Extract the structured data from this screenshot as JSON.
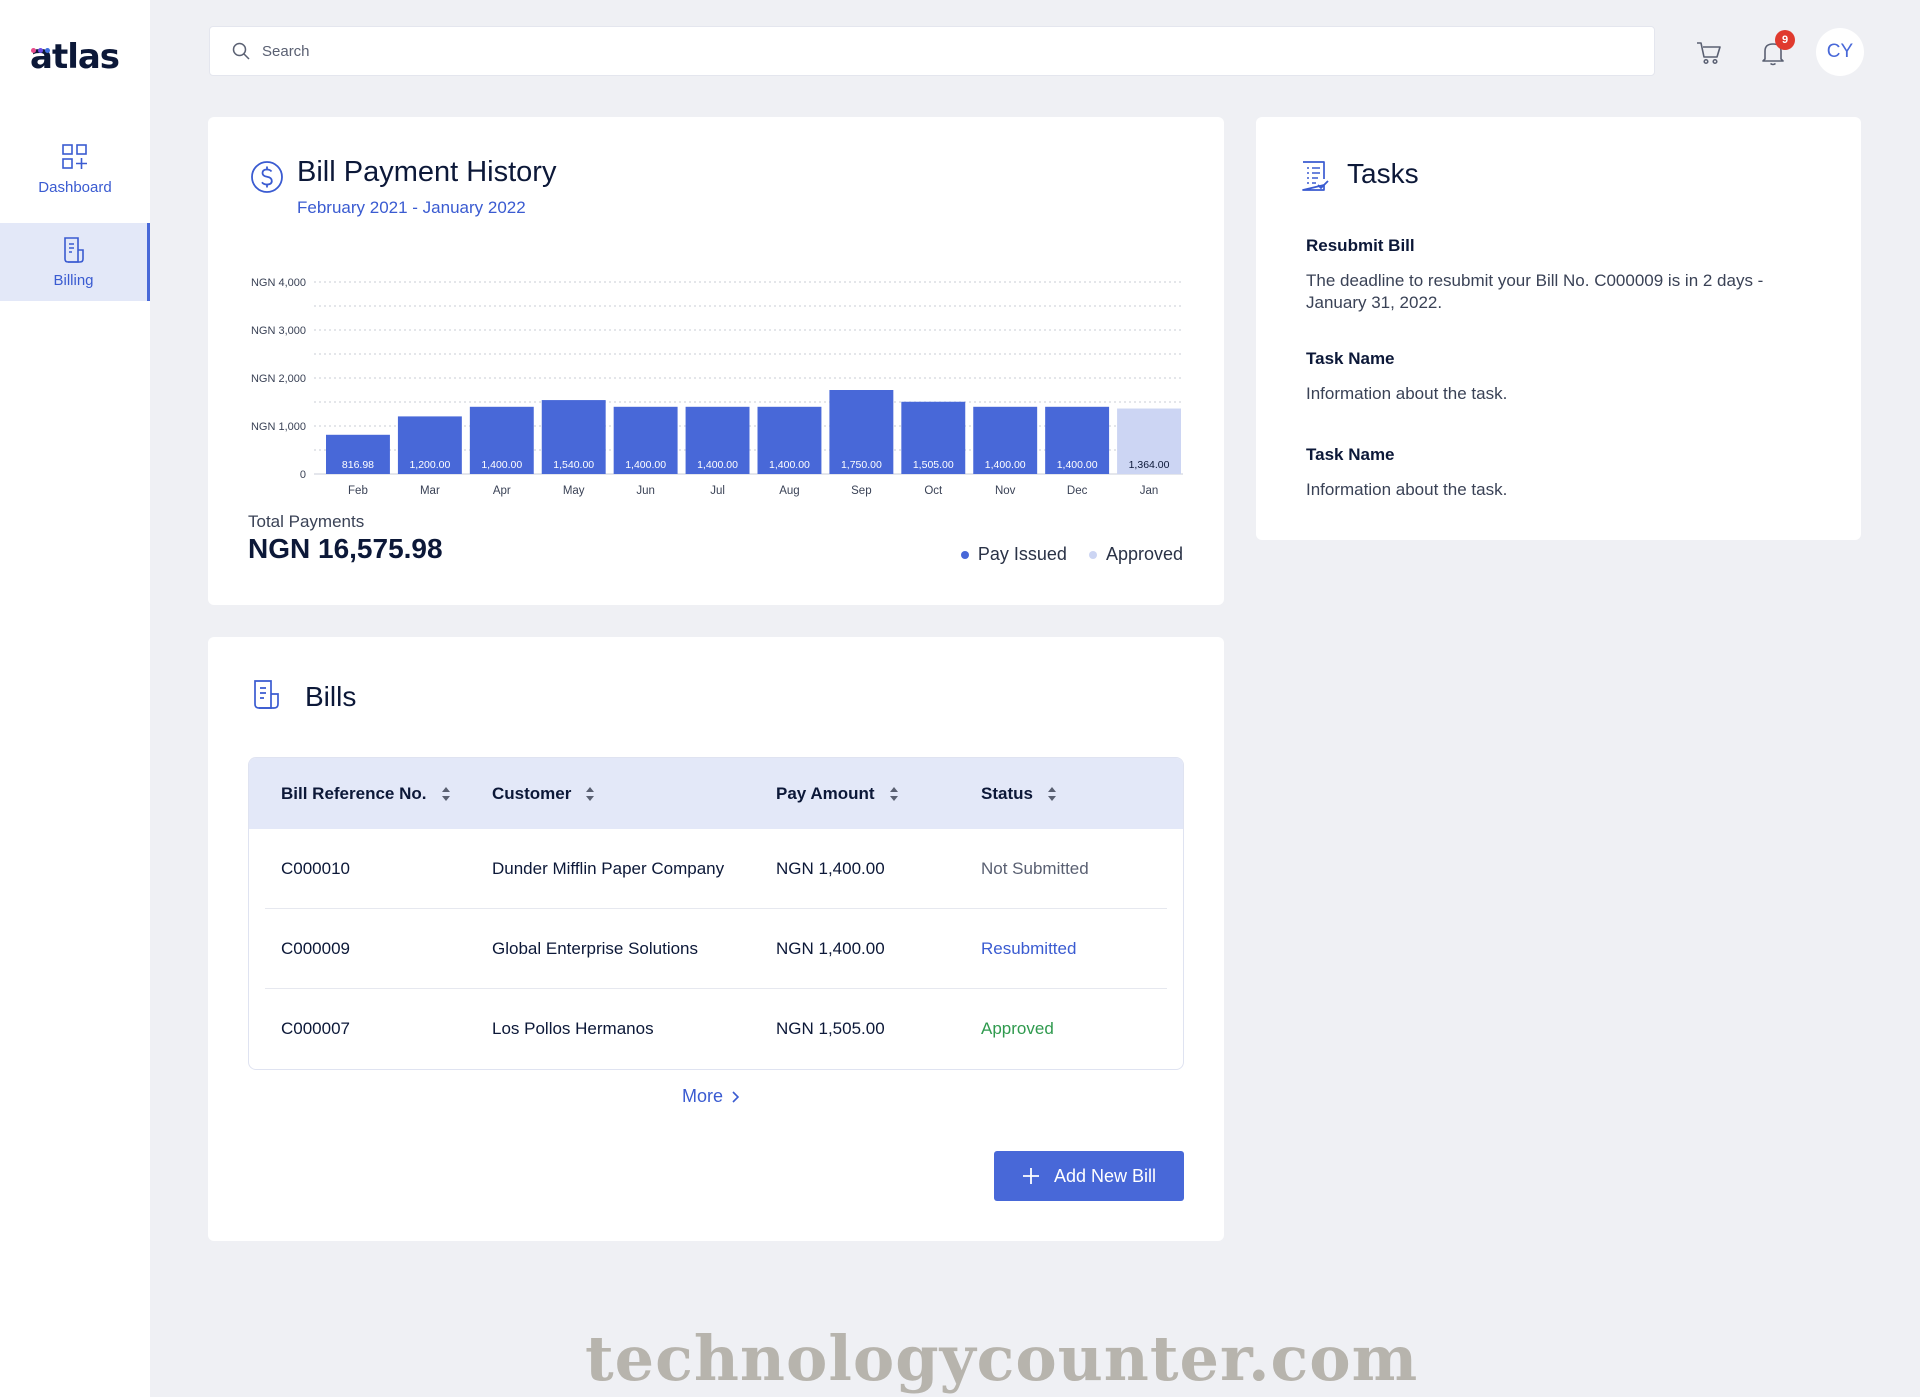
{
  "brand": {
    "name": "atlas",
    "dot_colors": [
      "#e94c8b",
      "#6d4ce6",
      "#3d6fe0"
    ]
  },
  "sidebar": {
    "items": [
      {
        "label": "Dashboard",
        "icon": "dashboard-grid-icon",
        "active": false
      },
      {
        "label": "Billing",
        "icon": "billing-document-icon",
        "active": true
      }
    ]
  },
  "topbar": {
    "search_placeholder": "Search",
    "notification_count": "9",
    "avatar_initials": "CY"
  },
  "history": {
    "title": "Bill Payment History",
    "subtitle": "February 2021 - January 2022",
    "total_label": "Total Payments",
    "total_value": "NGN 16,575.98",
    "legend": [
      {
        "label": "Pay Issued",
        "color": "#4868d8"
      },
      {
        "label": "Approved",
        "color": "#ccd5f3"
      }
    ]
  },
  "chart_data": {
    "type": "bar",
    "categories": [
      "Feb",
      "Mar",
      "Apr",
      "May",
      "Jun",
      "Jul",
      "Aug",
      "Sep",
      "Oct",
      "Nov",
      "Dec",
      "Jan"
    ],
    "values": [
      816.98,
      1200,
      1400,
      1540,
      1400,
      1400,
      1400,
      1750,
      1505,
      1400,
      1400,
      1364
    ],
    "value_labels": [
      "816.98",
      "1,200.00",
      "1,400.00",
      "1,540.00",
      "1,400.00",
      "1,400.00",
      "1,400.00",
      "1,750.00",
      "1,505.00",
      "1,400.00",
      "1,400.00",
      "1,364.00"
    ],
    "bar_status": [
      "Pay Issued",
      "Pay Issued",
      "Pay Issued",
      "Pay Issued",
      "Pay Issued",
      "Pay Issued",
      "Pay Issued",
      "Pay Issued",
      "Pay Issued",
      "Pay Issued",
      "Pay Issued",
      "Approved"
    ],
    "colors": {
      "Pay Issued": "#4868d8",
      "Approved": "#ccd5f3"
    },
    "y_ticks": [
      0,
      1000,
      2000,
      3000,
      4000
    ],
    "y_tick_labels": [
      "0",
      "NGN 1,000",
      "NGN 2,000",
      "NGN 3,000",
      "NGN 4,000"
    ],
    "ylim": [
      0,
      4000
    ],
    "grid": true
  },
  "tasks": {
    "title": "Tasks",
    "items": [
      {
        "title": "Resubmit Bill",
        "description": "The deadline to resubmit your Bill No. C000009 is in 2 days - January 31, 2022."
      },
      {
        "title": "Task Name",
        "description": "Information about the task."
      },
      {
        "title": "Task Name",
        "description": "Information about the task."
      }
    ]
  },
  "bills": {
    "title": "Bills",
    "columns": [
      "Bill Reference No.",
      "Customer",
      "Pay Amount",
      "Status"
    ],
    "rows": [
      {
        "ref": "C000010",
        "customer": "Dunder Mifflin Paper Company",
        "amount": "NGN 1,400.00",
        "status": "Not Submitted",
        "status_color": "#5a6072"
      },
      {
        "ref": "C000009",
        "customer": "Global Enterprise Solutions",
        "amount": "NGN 1,400.00",
        "status": "Resubmitted",
        "status_color": "#3a5bd1"
      },
      {
        "ref": "C000007",
        "customer": "Los Pollos Hermanos",
        "amount": "NGN 1,505.00",
        "status": "Approved",
        "status_color": "#2f9a4e"
      }
    ],
    "more_label": "More",
    "add_button_label": "Add New Bill"
  },
  "watermark": "technologycounter.com"
}
